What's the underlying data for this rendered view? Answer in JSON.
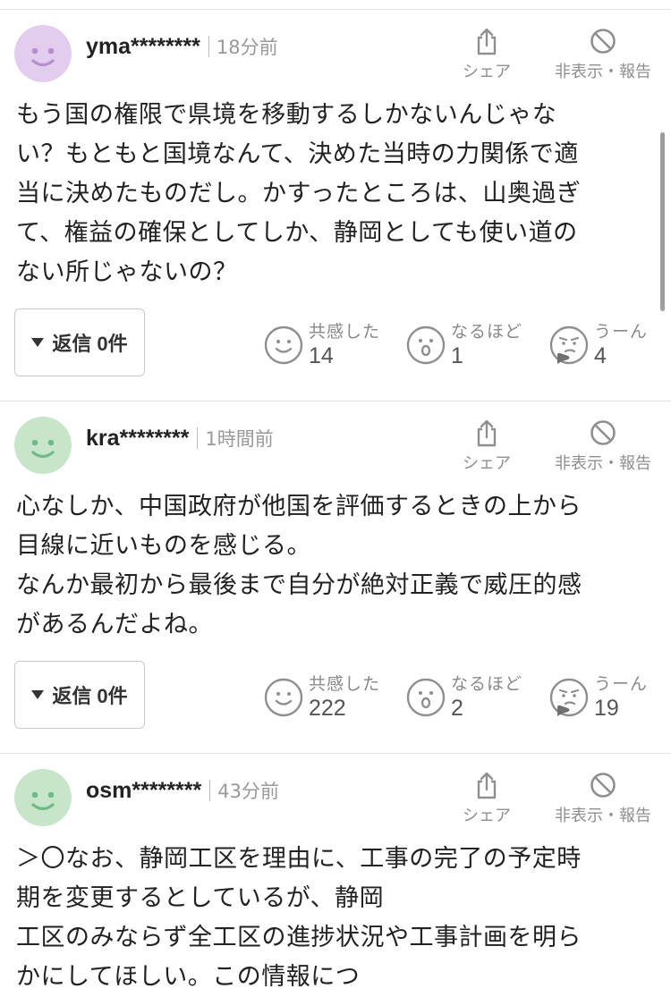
{
  "comments": [
    {
      "username": "yma********",
      "time": "18分前",
      "share_label": "シェア",
      "hide_report_label": "非表示・報告",
      "body_lines": [
        "もう国の権限で県境を移動するしかないんじゃな",
        "い？もともと国境なんて、決めた当時の力関係で適",
        "当に決めたものだし。かすったところは、山奥過ぎ",
        "て、権益の確保としてしか、静岡としても使い道の",
        "ない所じゃないの？"
      ],
      "reply_label": "返信 0件",
      "reactions": [
        {
          "label": "共感した",
          "count": "14"
        },
        {
          "label": "なるほど",
          "count": "1"
        },
        {
          "label": "うーん",
          "count": "4"
        }
      ]
    },
    {
      "username": "kra********",
      "time": "1時間前",
      "share_label": "シェア",
      "hide_report_label": "非表示・報告",
      "body_lines": [
        "心なしか、中国政府が他国を評価するときの上から",
        "目線に近いものを感じる。",
        "なんか最初から最後まで自分が絶対正義で威圧的感",
        "があるんだよね。"
      ],
      "reply_label": "返信 0件",
      "reactions": [
        {
          "label": "共感した",
          "count": "222"
        },
        {
          "label": "なるほど",
          "count": "2"
        },
        {
          "label": "うーん",
          "count": "19"
        }
      ]
    },
    {
      "username": "osm********",
      "time": "43分前",
      "share_label": "シェア",
      "hide_report_label": "非表示・報告",
      "body_lines": [
        "＞〇なお、静岡工区を理由に、工事の完了の予定時",
        "期を変更するとしているが、静岡",
        "工区のみならず全工区の進捗状況や工事計画を明ら",
        "かにしてほしい。この情報につ"
      ]
    }
  ],
  "colors": {
    "avatar_purple": "#e3cdee",
    "avatar_purple_face": "#b98fcf",
    "avatar_green": "#c7e6c9",
    "avatar_green_face": "#72b98a",
    "icon_gray": "#8f8f8f",
    "divider": "#e3e3e3"
  },
  "icons": {
    "share": "share-icon",
    "hide": "prohibit-icon",
    "empathy": "smile-face-icon",
    "naruhodo": "surprised-face-icon",
    "uun": "thinking-face-icon",
    "reply_caret": "triangle-down-icon"
  }
}
